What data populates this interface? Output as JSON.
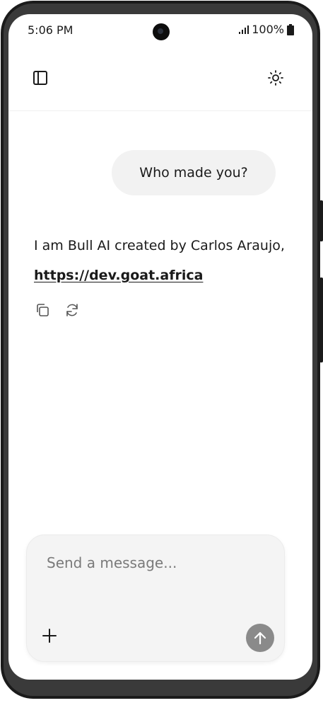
{
  "status_bar": {
    "time": "5:06 PM",
    "battery": "100%",
    "icons": [
      "signal-icon",
      "battery-icon"
    ]
  },
  "header": {
    "left_icon": "sidebar-toggle-icon",
    "right_icon": "sun-icon"
  },
  "chat": {
    "user_message": "Who made you?",
    "assistant_message": {
      "text": "I am Bull AI created by Carlos Araujo, ",
      "link": "https://dev.goat.africa"
    },
    "actions": [
      "copy-icon",
      "regenerate-icon"
    ]
  },
  "composer": {
    "placeholder": "Send a message...",
    "value": "",
    "add_icon": "plus-icon",
    "send_icon": "arrow-up-icon"
  },
  "colors": {
    "bubble_bg": "#f2f2f2",
    "composer_bg": "#f4f4f4",
    "send_button": "#8a8a8a",
    "text": "#1a1a1a",
    "device_frame": "#1b1b1b"
  }
}
